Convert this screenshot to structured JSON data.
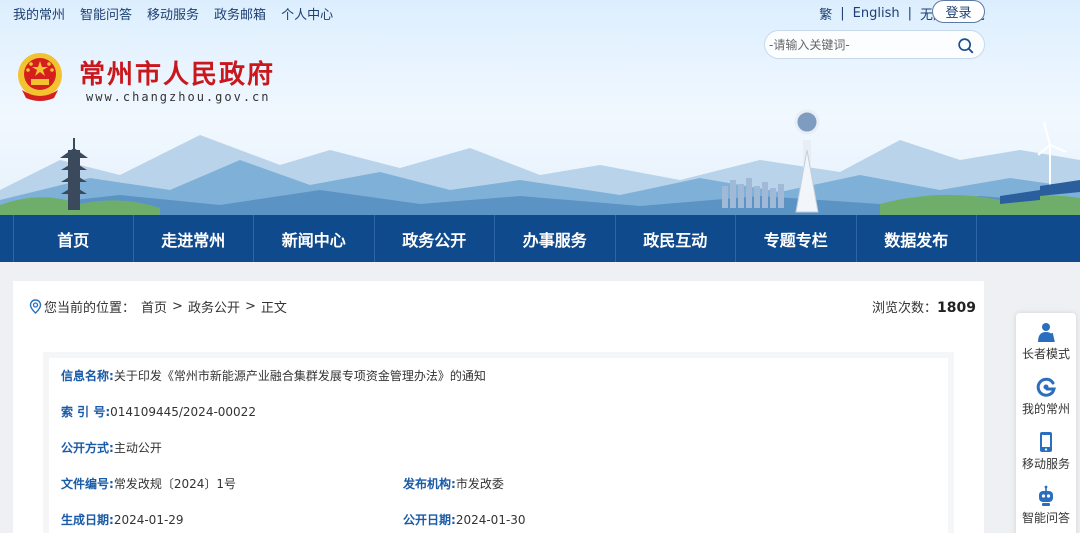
{
  "header": {
    "top_links": [
      "我的常州",
      "智能问答",
      "移动服务",
      "政务邮箱",
      "个人中心"
    ],
    "lang_links": [
      "繁",
      "English",
      "无障碍浏览"
    ],
    "login_label": "登录",
    "search_placeholder": "-请输入关键词-",
    "site_title": "常州市人民政府",
    "site_url": "www.changzhou.gov.cn"
  },
  "nav": {
    "items": [
      "首页",
      "走进常州",
      "新闻中心",
      "政务公开",
      "办事服务",
      "政民互动",
      "专题专栏",
      "数据发布"
    ]
  },
  "breadcrumb": {
    "prefix": "您当前的位置：",
    "items": [
      "首页",
      "政务公开",
      "正文"
    ],
    "separator": ">"
  },
  "views": {
    "label": "浏览次数：",
    "count": "1809"
  },
  "info": {
    "title_label": "信息名称:",
    "title_value": "关于印发《常州市新能源产业融合集群发展专项资金管理办法》的通知",
    "index_label": "索 引 号:",
    "index_value": "014109445/2024-00022",
    "open_mode_label": "公开方式:",
    "open_mode_value": "主动公开",
    "doc_no_label": "文件编号:",
    "doc_no_value": "常发改规〔2024〕1号",
    "org_label": "发布机构:",
    "org_value": "市发改委",
    "created_label": "生成日期:",
    "created_value": "2024-01-29",
    "published_label": "公开日期:",
    "published_value": "2024-01-30"
  },
  "side_toolbar": {
    "items": [
      {
        "label": "长者模式",
        "icon": "elder-icon"
      },
      {
        "label": "我的常州",
        "icon": "mycz-icon"
      },
      {
        "label": "移动服务",
        "icon": "mobile-icon"
      },
      {
        "label": "智能问答",
        "icon": "robot-icon"
      }
    ]
  },
  "colors": {
    "nav_bg": "#0f4a8d",
    "title_red": "#c9171c",
    "label_blue": "#1a5ba8"
  }
}
